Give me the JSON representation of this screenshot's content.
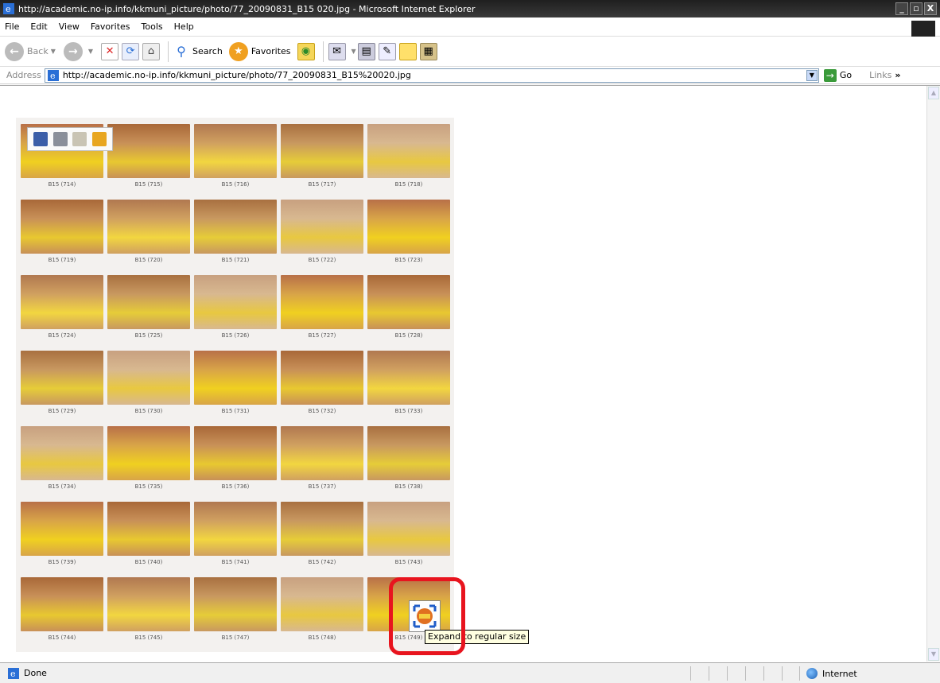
{
  "window": {
    "title": "http://academic.no-ip.info/kkmuni_picture/photo/77_20090831_B15 020.jpg - Microsoft Internet Explorer",
    "buttons": [
      "_",
      "▫",
      "X"
    ]
  },
  "menu": {
    "items": [
      "File",
      "Edit",
      "View",
      "Favorites",
      "Tools",
      "Help"
    ]
  },
  "toolbar": {
    "back_label": "Back",
    "search_label": "Search",
    "favorites_label": "Favorites"
  },
  "address": {
    "label": "Address",
    "url": "http://academic.no-ip.info/kkmuni_picture/photo/77_20090831_B15%20020.jpg",
    "go_label": "Go",
    "links_label": "Links"
  },
  "sheet": {
    "captions": [
      [
        "B15 (714)",
        "B15 (715)",
        "B15 (716)",
        "B15 (717)",
        "B15 (718)"
      ],
      [
        "B15 (719)",
        "B15 (720)",
        "B15 (721)",
        "B15 (722)",
        "B15 (723)"
      ],
      [
        "B15 (724)",
        "B15 (725)",
        "B15 (726)",
        "B15 (727)",
        "B15 (728)"
      ],
      [
        "B15 (729)",
        "B15 (730)",
        "B15 (731)",
        "B15 (732)",
        "B15 (733)"
      ],
      [
        "B15 (734)",
        "B15 (735)",
        "B15 (736)",
        "B15 (737)",
        "B15 (738)"
      ],
      [
        "B15 (739)",
        "B15 (740)",
        "B15 (741)",
        "B15 (742)",
        "B15 (743)"
      ],
      [
        "B15 (744)",
        "B15 (745)",
        "B15 (747)",
        "B15 (748)",
        "B15 (749)"
      ]
    ]
  },
  "image_toolbar": {
    "icons": [
      "save-icon",
      "print-icon",
      "email-icon",
      "my-pictures-icon"
    ]
  },
  "tooltip": {
    "text": "Expand to regular size"
  },
  "status": {
    "text": "Done",
    "zone": "Internet"
  },
  "colors": {
    "highlight": "#e8141e",
    "title_bar": "#2b2b2b",
    "tooltip_bg": "#ffffe1"
  }
}
